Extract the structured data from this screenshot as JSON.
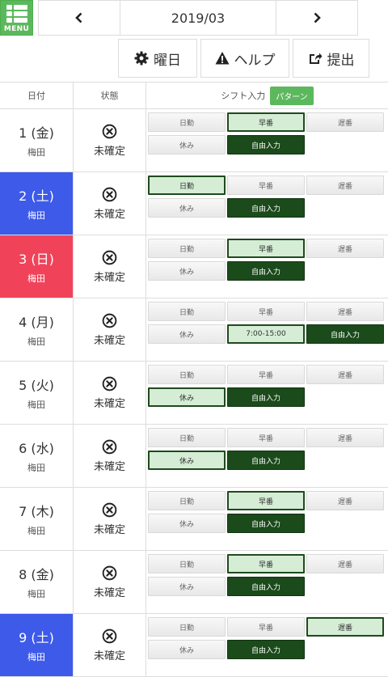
{
  "menu": {
    "label": "MENU"
  },
  "month_nav": {
    "title": "2019/03"
  },
  "toolbar": {
    "weekday_label": "曜日",
    "help_label": "ヘルプ",
    "submit_label": "提出"
  },
  "table": {
    "headers": {
      "date": "日付",
      "status": "状態",
      "shift": "シフト入力",
      "pattern_button": "パターン"
    },
    "rows": [
      {
        "day": "1 (金)",
        "location": "梅田",
        "status": "未確定",
        "day_type": "weekday",
        "buttons": [
          {
            "label": "日勤",
            "state": "normal"
          },
          {
            "label": "早番",
            "state": "selected"
          },
          {
            "label": "遅番",
            "state": "normal"
          },
          {
            "label": "休み",
            "state": "normal"
          },
          {
            "label": "自由入力",
            "state": "dark"
          }
        ]
      },
      {
        "day": "2 (土)",
        "location": "梅田",
        "status": "未確定",
        "day_type": "saturday",
        "buttons": [
          {
            "label": "日勤",
            "state": "selected"
          },
          {
            "label": "早番",
            "state": "normal"
          },
          {
            "label": "遅番",
            "state": "normal"
          },
          {
            "label": "休み",
            "state": "normal"
          },
          {
            "label": "自由入力",
            "state": "dark"
          }
        ]
      },
      {
        "day": "3 (日)",
        "location": "梅田",
        "status": "未確定",
        "day_type": "sunday",
        "buttons": [
          {
            "label": "日勤",
            "state": "normal"
          },
          {
            "label": "早番",
            "state": "selected"
          },
          {
            "label": "遅番",
            "state": "normal"
          },
          {
            "label": "休み",
            "state": "normal"
          },
          {
            "label": "自由入力",
            "state": "dark"
          }
        ]
      },
      {
        "day": "4 (月)",
        "location": "梅田",
        "status": "未確定",
        "day_type": "weekday",
        "buttons": [
          {
            "label": "日勤",
            "state": "normal"
          },
          {
            "label": "早番",
            "state": "normal"
          },
          {
            "label": "遅番",
            "state": "normal"
          },
          {
            "label": "休み",
            "state": "normal"
          },
          {
            "label": "7:00-15:00",
            "state": "selected"
          },
          {
            "label": "自由入力",
            "state": "dark"
          }
        ]
      },
      {
        "day": "5 (火)",
        "location": "梅田",
        "status": "未確定",
        "day_type": "weekday",
        "buttons": [
          {
            "label": "日勤",
            "state": "normal"
          },
          {
            "label": "早番",
            "state": "normal"
          },
          {
            "label": "遅番",
            "state": "normal"
          },
          {
            "label": "休み",
            "state": "selected"
          },
          {
            "label": "自由入力",
            "state": "dark"
          }
        ]
      },
      {
        "day": "6 (水)",
        "location": "梅田",
        "status": "未確定",
        "day_type": "weekday",
        "buttons": [
          {
            "label": "日勤",
            "state": "normal"
          },
          {
            "label": "早番",
            "state": "normal"
          },
          {
            "label": "遅番",
            "state": "normal"
          },
          {
            "label": "休み",
            "state": "selected"
          },
          {
            "label": "自由入力",
            "state": "dark"
          }
        ]
      },
      {
        "day": "7 (木)",
        "location": "梅田",
        "status": "未確定",
        "day_type": "weekday",
        "buttons": [
          {
            "label": "日勤",
            "state": "normal"
          },
          {
            "label": "早番",
            "state": "selected"
          },
          {
            "label": "遅番",
            "state": "normal"
          },
          {
            "label": "休み",
            "state": "normal"
          },
          {
            "label": "自由入力",
            "state": "dark"
          }
        ]
      },
      {
        "day": "8 (金)",
        "location": "梅田",
        "status": "未確定",
        "day_type": "weekday",
        "buttons": [
          {
            "label": "日勤",
            "state": "normal"
          },
          {
            "label": "早番",
            "state": "selected"
          },
          {
            "label": "遅番",
            "state": "normal"
          },
          {
            "label": "休み",
            "state": "normal"
          },
          {
            "label": "自由入力",
            "state": "dark"
          }
        ]
      },
      {
        "day": "9 (土)",
        "location": "梅田",
        "status": "未確定",
        "day_type": "saturday",
        "buttons": [
          {
            "label": "日勤",
            "state": "normal"
          },
          {
            "label": "早番",
            "state": "normal"
          },
          {
            "label": "遅番",
            "state": "selected"
          },
          {
            "label": "休み",
            "state": "normal"
          },
          {
            "label": "自由入力",
            "state": "dark"
          }
        ]
      }
    ]
  }
}
